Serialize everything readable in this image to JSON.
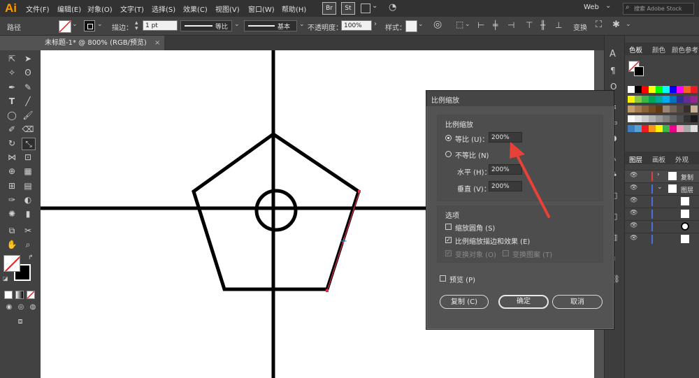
{
  "menubar": {
    "logo": "Ai",
    "menus": [
      "文件(F)",
      "编辑(E)",
      "对象(O)",
      "文字(T)",
      "选择(S)",
      "效果(C)",
      "视图(V)",
      "窗口(W)",
      "帮助(H)"
    ],
    "bridge_label": "Br",
    "stock_label": "St",
    "workspace": "Web",
    "search_placeholder": "搜索 Adobe Stock"
  },
  "control_bar": {
    "object_type": "路径",
    "stroke_label": "描边：",
    "stroke_weight": "1 pt",
    "profile_label": "等比",
    "brush_label": "基本",
    "opacity_label": "不透明度：",
    "opacity_value": "100%",
    "style_label": "样式：",
    "transform_label": "变换"
  },
  "document": {
    "tab_title": "未标题-1* @ 800% (RGB/预览)"
  },
  "panels": {
    "swatches_tabs": [
      "色板",
      "颜色",
      "颜色参考"
    ],
    "layers_tabs": [
      "图层",
      "画板",
      "外观"
    ],
    "layer_rows": [
      "复制",
      "图层"
    ],
    "swatch_colors": [
      [
        "#ffffff",
        "#000000",
        "#ff0000",
        "#ffff00",
        "#00ff00",
        "#00ffff",
        "#0000ff",
        "#ff00ff",
        "#f26522",
        "#ed1c24"
      ],
      [
        "#fff200",
        "#8dc63f",
        "#39b54a",
        "#00a651",
        "#00a99d",
        "#00aeef",
        "#0072bc",
        "#2e3192",
        "#662d91",
        "#92278f"
      ],
      [
        "#c69c6d",
        "#a67c52",
        "#8c6239",
        "#754c24",
        "#603913",
        "#998675",
        "#736357",
        "#534741",
        "#362f2d",
        "#c7b299"
      ],
      [
        "#ffffff",
        "#e6e6e6",
        "#cccccc",
        "#b3b3b3",
        "#999999",
        "#808080",
        "#666666",
        "#4d4d4d",
        "#333333",
        "#1a1a1a"
      ],
      [
        "#3f7fbf",
        "#56a0d3",
        "#ed1c24",
        "#f7941d",
        "#fff200",
        "#39b54a",
        "#ed008c",
        "#f49ac1",
        "#aaaaaa",
        "#dddddd"
      ]
    ]
  },
  "dialog": {
    "title": "比例缩放",
    "scale_group_label": "比例缩放",
    "uniform_label": "等比 (U)：",
    "uniform_value": "200%",
    "nonuniform_label": "不等比 (N)",
    "horizontal_label": "水平 (H)：",
    "horizontal_value": "200%",
    "vertical_label": "垂直 (V)：",
    "vertical_value": "200%",
    "options_label": "选项",
    "scale_corners_label": "缩放圆角 (S)",
    "scale_strokes_label": "比例缩放描边和效果 (E)",
    "transform_objects_label": "变换对象 (O)",
    "transform_patterns_label": "变换图案 (T)",
    "preview_label": "预览 (P)",
    "copy_button": "复制 (C)",
    "ok_button": "确定",
    "cancel_button": "取消"
  },
  "colors": {
    "accent_arrow": "#e8413a",
    "path_highlight": "#e0304a"
  }
}
